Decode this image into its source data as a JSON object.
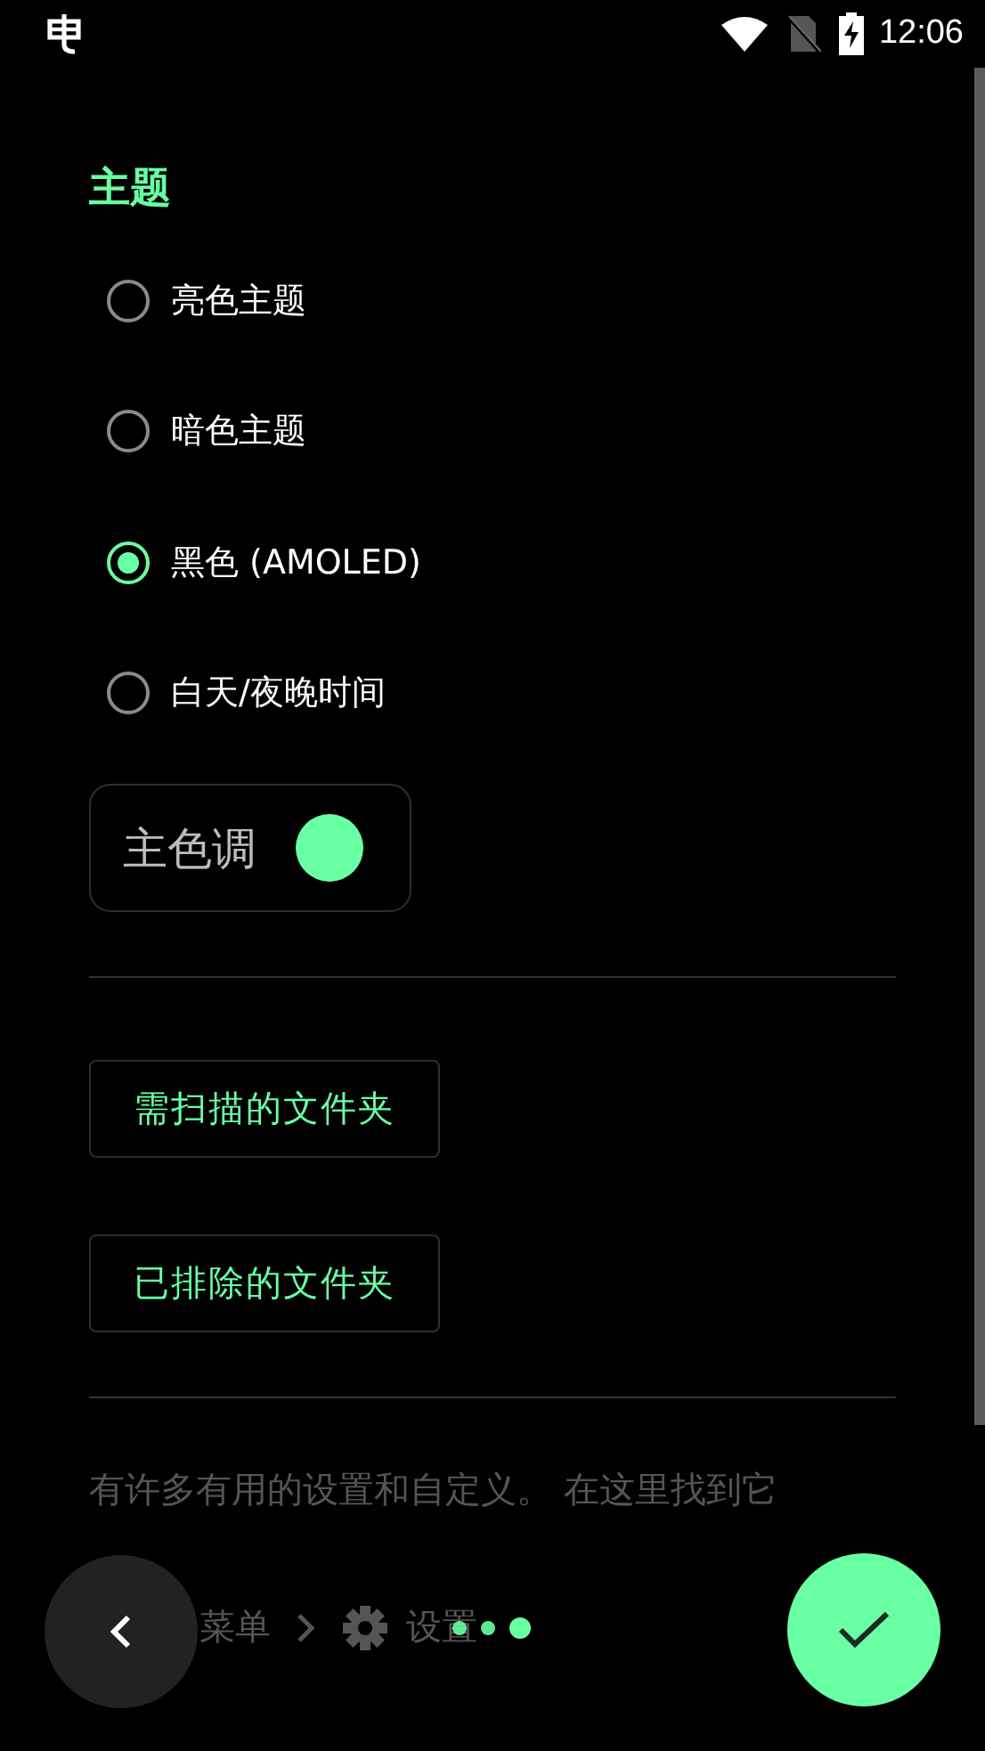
{
  "status_bar": {
    "time": "12:06"
  },
  "section_title": "主题",
  "theme_options": [
    {
      "label": "亮色主题",
      "selected": false
    },
    {
      "label": "暗色主题",
      "selected": false
    },
    {
      "label": "黑色 (AMOLED)",
      "selected": true
    },
    {
      "label": "白天/夜晚时间",
      "selected": false
    }
  ],
  "accent_color": {
    "label": "主色调",
    "color": "#69ffa3"
  },
  "folder_buttons": [
    "需扫描的文件夹",
    "已排除的文件夹"
  ],
  "intro_text": "有许多有用的设置和自定义。 在这里找到它",
  "breadcrumb": [
    "菜单",
    "设置"
  ],
  "page_indicator": [
    {
      "selected": false
    },
    {
      "selected": false
    },
    {
      "selected": true
    }
  ]
}
